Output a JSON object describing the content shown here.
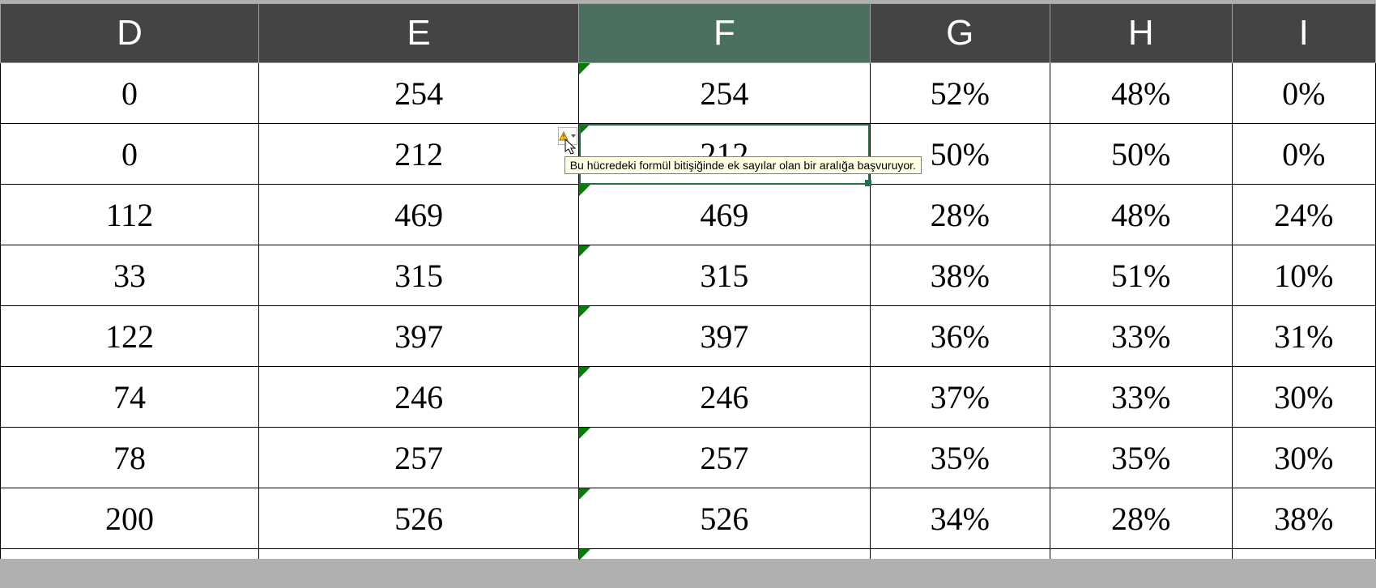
{
  "headers": {
    "D": "D",
    "E": "E",
    "F": "F",
    "G": "G",
    "H": "H",
    "I": "I"
  },
  "rows": [
    {
      "D": "0",
      "E": "254",
      "F": "254",
      "G": "52%",
      "H": "48%",
      "I": "0%"
    },
    {
      "D": "0",
      "E": "212",
      "F": "212",
      "G": "50%",
      "H": "50%",
      "I": "0%"
    },
    {
      "D": "112",
      "E": "469",
      "F": "469",
      "G": "28%",
      "H": "48%",
      "I": "24%"
    },
    {
      "D": "33",
      "E": "315",
      "F": "315",
      "G": "38%",
      "H": "51%",
      "I": "10%"
    },
    {
      "D": "122",
      "E": "397",
      "F": "397",
      "G": "36%",
      "H": "33%",
      "I": "31%"
    },
    {
      "D": "74",
      "E": "246",
      "F": "246",
      "G": "37%",
      "H": "33%",
      "I": "30%"
    },
    {
      "D": "78",
      "E": "257",
      "F": "257",
      "G": "35%",
      "H": "35%",
      "I": "30%"
    },
    {
      "D": "200",
      "E": "526",
      "F": "526",
      "G": "34%",
      "H": "28%",
      "I": "38%"
    }
  ],
  "selected": {
    "col": "F",
    "row_index": 1
  },
  "tooltip": "Bu hücredeki formül bitişiğinde ek sayılar olan bir aralığa başvuruyor.",
  "colors": {
    "header_bg": "#444444",
    "header_sel": "#4c7060",
    "cell_sel": "#217346",
    "err_tri": "#008000"
  }
}
